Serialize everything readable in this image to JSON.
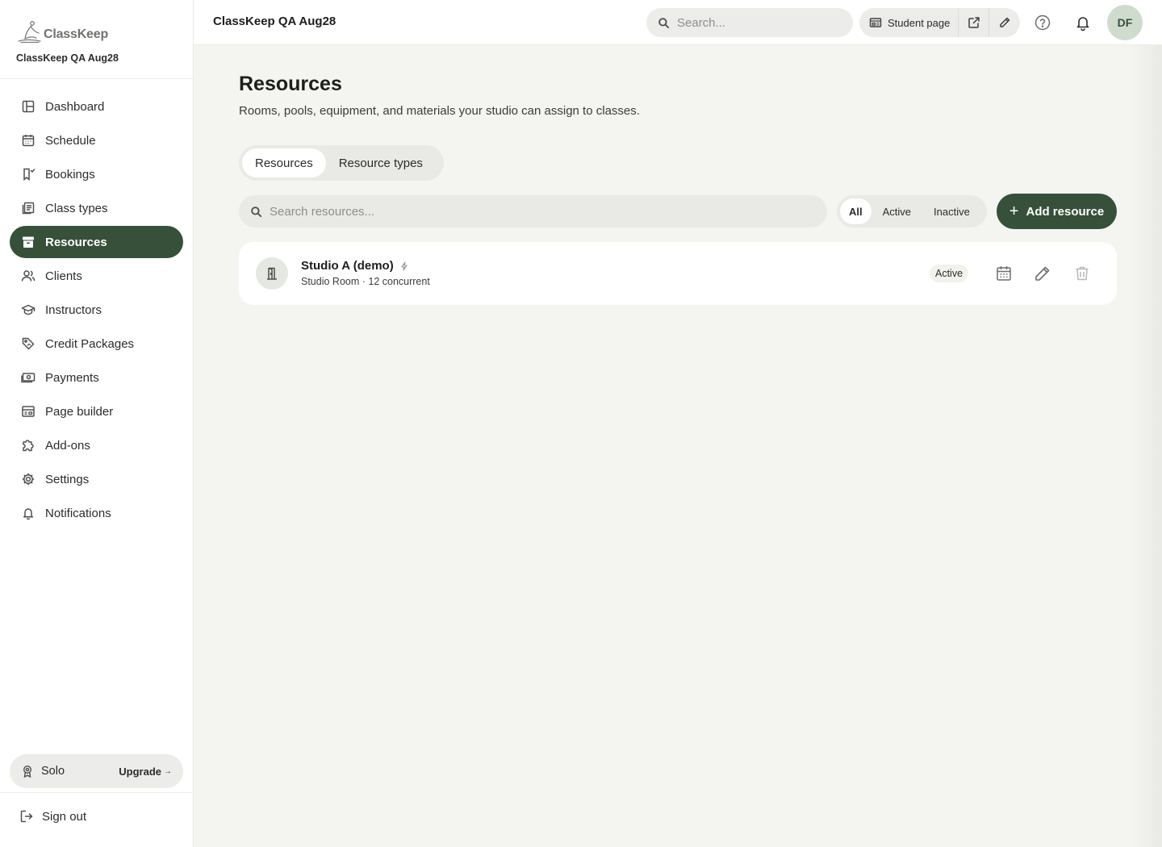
{
  "brand": {
    "logo_text": "ClassKeep",
    "studio_name": "ClassKeep QA Aug28"
  },
  "sidebar": {
    "items": [
      {
        "label": "Dashboard",
        "icon": "dashboard-icon"
      },
      {
        "label": "Schedule",
        "icon": "calendar-icon"
      },
      {
        "label": "Bookings",
        "icon": "bookmark-icon"
      },
      {
        "label": "Class types",
        "icon": "list-icon"
      },
      {
        "label": "Resources",
        "icon": "archive-icon",
        "active": true
      },
      {
        "label": "Clients",
        "icon": "users-icon"
      },
      {
        "label": "Instructors",
        "icon": "graduation-cap-icon"
      },
      {
        "label": "Credit Packages",
        "icon": "tag-icon"
      },
      {
        "label": "Payments",
        "icon": "banknote-icon"
      },
      {
        "label": "Page builder",
        "icon": "layout-icon"
      },
      {
        "label": "Add-ons",
        "icon": "puzzle-icon"
      },
      {
        "label": "Settings",
        "icon": "gear-icon"
      },
      {
        "label": "Notifications",
        "icon": "bell-icon"
      }
    ],
    "plan": {
      "name": "Solo",
      "upgrade_label": "Upgrade",
      "upgrade_arrow": "→"
    },
    "signout_label": "Sign out"
  },
  "topbar": {
    "title": "ClassKeep QA Aug28",
    "search_placeholder": "Search...",
    "student_page_label": "Student page",
    "avatar_initials": "DF"
  },
  "main": {
    "title": "Resources",
    "subtitle": "Rooms, pools, equipment, and materials your studio can assign to classes.",
    "tabs": [
      {
        "label": "Resources",
        "active": true
      },
      {
        "label": "Resource types",
        "active": false
      }
    ],
    "search_placeholder": "Search resources...",
    "filters": [
      {
        "label": "All",
        "active": true
      },
      {
        "label": "Active",
        "active": false
      },
      {
        "label": "Inactive",
        "active": false
      }
    ],
    "add_button": {
      "plus": "+",
      "label": "Add resource"
    },
    "resources": [
      {
        "name": "Studio A (demo)",
        "meta": "Studio Room · 12 concurrent",
        "status": "Active"
      }
    ]
  },
  "colors": {
    "accent": "#36503a",
    "background": "#f4f4f1",
    "avatar_bg": "#cfdccd"
  }
}
